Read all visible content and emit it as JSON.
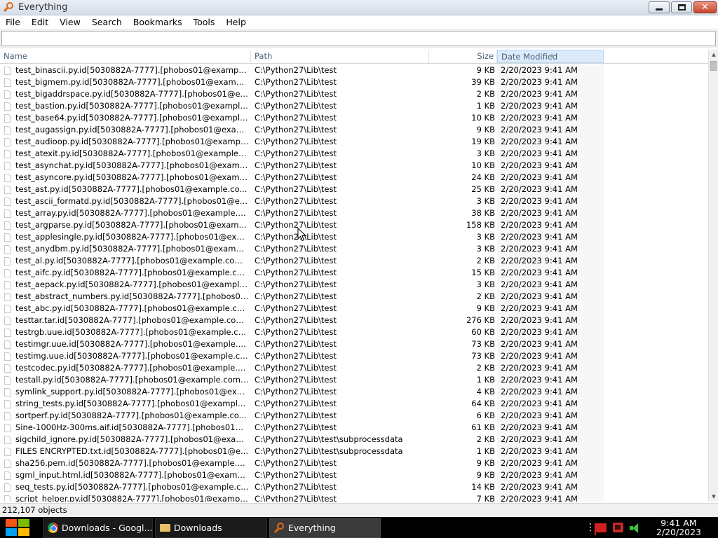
{
  "window": {
    "title": "Everything",
    "icon": "search-magnifier-icon"
  },
  "menu": [
    "File",
    "Edit",
    "View",
    "Search",
    "Bookmarks",
    "Tools",
    "Help"
  ],
  "search": {
    "value": "",
    "placeholder": ""
  },
  "columns": {
    "name": "Name",
    "path": "Path",
    "size": "Size",
    "date": "Date Modified"
  },
  "rows": [
    {
      "name": "test_binascii.py.id[5030882A-7777].[phobos01@example...",
      "path": "C:\\Python27\\Lib\\test",
      "size": "9 KB",
      "date": "2/20/2023 9:41 AM"
    },
    {
      "name": "test_bigmem.py.id[5030882A-7777].[phobos01@example...",
      "path": "C:\\Python27\\Lib\\test",
      "size": "39 KB",
      "date": "2/20/2023 9:41 AM"
    },
    {
      "name": "test_bigaddrspace.py.id[5030882A-7777].[phobos01@ex...",
      "path": "C:\\Python27\\Lib\\test",
      "size": "2 KB",
      "date": "2/20/2023 9:41 AM"
    },
    {
      "name": "test_bastion.py.id[5030882A-7777].[phobos01@example...",
      "path": "C:\\Python27\\Lib\\test",
      "size": "1 KB",
      "date": "2/20/2023 9:41 AM"
    },
    {
      "name": "test_base64.py.id[5030882A-7777].[phobos01@example...",
      "path": "C:\\Python27\\Lib\\test",
      "size": "10 KB",
      "date": "2/20/2023 9:41 AM"
    },
    {
      "name": "test_augassign.py.id[5030882A-7777].[phobos01@exam...",
      "path": "C:\\Python27\\Lib\\test",
      "size": "9 KB",
      "date": "2/20/2023 9:41 AM"
    },
    {
      "name": "test_audioop.py.id[5030882A-7777].[phobos01@exampl...",
      "path": "C:\\Python27\\Lib\\test",
      "size": "19 KB",
      "date": "2/20/2023 9:41 AM"
    },
    {
      "name": "test_atexit.py.id[5030882A-7777].[phobos01@example.c...",
      "path": "C:\\Python27\\Lib\\test",
      "size": "3 KB",
      "date": "2/20/2023 9:41 AM"
    },
    {
      "name": "test_asynchat.py.id[5030882A-7777].[phobos01@exampl...",
      "path": "C:\\Python27\\Lib\\test",
      "size": "10 KB",
      "date": "2/20/2023 9:41 AM"
    },
    {
      "name": "test_asyncore.py.id[5030882A-7777].[phobos01@examp...",
      "path": "C:\\Python27\\Lib\\test",
      "size": "24 KB",
      "date": "2/20/2023 9:41 AM"
    },
    {
      "name": "test_ast.py.id[5030882A-7777].[phobos01@example.co...",
      "path": "C:\\Python27\\Lib\\test",
      "size": "25 KB",
      "date": "2/20/2023 9:41 AM"
    },
    {
      "name": "test_ascii_formatd.py.id[5030882A-7777].[phobos01@ex...",
      "path": "C:\\Python27\\Lib\\test",
      "size": "3 KB",
      "date": "2/20/2023 9:41 AM"
    },
    {
      "name": "test_array.py.id[5030882A-7777].[phobos01@example.c...",
      "path": "C:\\Python27\\Lib\\test",
      "size": "38 KB",
      "date": "2/20/2023 9:41 AM"
    },
    {
      "name": "test_argparse.py.id[5030882A-7777].[phobos01@examp...",
      "path": "C:\\Python27\\Lib\\test",
      "size": "158 KB",
      "date": "2/20/2023 9:41 AM"
    },
    {
      "name": "test_applesingle.py.id[5030882A-7777].[phobos01@exa...",
      "path": "C:\\Python27\\Lib\\test",
      "size": "3 KB",
      "date": "2/20/2023 9:41 AM"
    },
    {
      "name": "test_anydbm.py.id[5030882A-7777].[phobos01@example...",
      "path": "C:\\Python27\\Lib\\test",
      "size": "3 KB",
      "date": "2/20/2023 9:41 AM"
    },
    {
      "name": "test_al.py.id[5030882A-7777].[phobos01@example.com]...",
      "path": "C:\\Python27\\Lib\\test",
      "size": "2 KB",
      "date": "2/20/2023 9:41 AM"
    },
    {
      "name": "test_aifc.py.id[5030882A-7777].[phobos01@example.co...",
      "path": "C:\\Python27\\Lib\\test",
      "size": "15 KB",
      "date": "2/20/2023 9:41 AM"
    },
    {
      "name": "test_aepack.py.id[5030882A-7777].[phobos01@example...",
      "path": "C:\\Python27\\Lib\\test",
      "size": "3 KB",
      "date": "2/20/2023 9:41 AM"
    },
    {
      "name": "test_abstract_numbers.py.id[5030882A-7777].[phobos01...",
      "path": "C:\\Python27\\Lib\\test",
      "size": "2 KB",
      "date": "2/20/2023 9:41 AM"
    },
    {
      "name": "test_abc.py.id[5030882A-7777].[phobos01@example.co...",
      "path": "C:\\Python27\\Lib\\test",
      "size": "9 KB",
      "date": "2/20/2023 9:41 AM"
    },
    {
      "name": "testtar.tar.id[5030882A-7777].[phobos01@example.com...",
      "path": "C:\\Python27\\Lib\\test",
      "size": "276 KB",
      "date": "2/20/2023 9:41 AM"
    },
    {
      "name": "testrgb.uue.id[5030882A-7777].[phobos01@example.co...",
      "path": "C:\\Python27\\Lib\\test",
      "size": "60 KB",
      "date": "2/20/2023 9:41 AM"
    },
    {
      "name": "testimgr.uue.id[5030882A-7777].[phobos01@example.co...",
      "path": "C:\\Python27\\Lib\\test",
      "size": "73 KB",
      "date": "2/20/2023 9:41 AM"
    },
    {
      "name": "testimg.uue.id[5030882A-7777].[phobos01@example.co...",
      "path": "C:\\Python27\\Lib\\test",
      "size": "73 KB",
      "date": "2/20/2023 9:41 AM"
    },
    {
      "name": "testcodec.py.id[5030882A-7777].[phobos01@example.c...",
      "path": "C:\\Python27\\Lib\\test",
      "size": "2 KB",
      "date": "2/20/2023 9:41 AM"
    },
    {
      "name": "testall.py.id[5030882A-7777].[phobos01@example.com]....",
      "path": "C:\\Python27\\Lib\\test",
      "size": "1 KB",
      "date": "2/20/2023 9:41 AM"
    },
    {
      "name": "symlink_support.py.id[5030882A-7777].[phobos01@exam...",
      "path": "C:\\Python27\\Lib\\test",
      "size": "4 KB",
      "date": "2/20/2023 9:41 AM"
    },
    {
      "name": "string_tests.py.id[5030882A-7777].[phobos01@example....",
      "path": "C:\\Python27\\Lib\\test",
      "size": "64 KB",
      "date": "2/20/2023 9:41 AM"
    },
    {
      "name": "sortperf.py.id[5030882A-7777].[phobos01@example.co...",
      "path": "C:\\Python27\\Lib\\test",
      "size": "6 KB",
      "date": "2/20/2023 9:41 AM"
    },
    {
      "name": "Sine-1000Hz-300ms.aif.id[5030882A-7777].[phobos01@...",
      "path": "C:\\Python27\\Lib\\test",
      "size": "61 KB",
      "date": "2/20/2023 9:41 AM"
    },
    {
      "name": "sigchild_ignore.py.id[5030882A-7777].[phobos01@examp...",
      "path": "C:\\Python27\\Lib\\test\\subprocessdata",
      "size": "2 KB",
      "date": "2/20/2023 9:41 AM"
    },
    {
      "name": "FILES ENCRYPTED.txt.id[5030882A-7777].[phobos01@e...",
      "path": "C:\\Python27\\Lib\\test\\subprocessdata",
      "size": "1 KB",
      "date": "2/20/2023 9:41 AM"
    },
    {
      "name": "sha256.pem.id[5030882A-7777].[phobos01@example.co...",
      "path": "C:\\Python27\\Lib\\test",
      "size": "9 KB",
      "date": "2/20/2023 9:41 AM"
    },
    {
      "name": "sgml_input.html.id[5030882A-7777].[phobos01@example...",
      "path": "C:\\Python27\\Lib\\test",
      "size": "9 KB",
      "date": "2/20/2023 9:41 AM"
    },
    {
      "name": "seq_tests.py.id[5030882A-7777].[phobos01@example.c...",
      "path": "C:\\Python27\\Lib\\test",
      "size": "14 KB",
      "date": "2/20/2023 9:41 AM"
    },
    {
      "name": "script_helper.py.id[5030882A-7777].[phobos01@example...",
      "path": "C:\\Python27\\Lib\\test",
      "size": "7 KB",
      "date": "2/20/2023 9:41 AM"
    }
  ],
  "status": {
    "objects": "212,107 objects"
  },
  "taskbar": {
    "tasks": [
      {
        "label": "Downloads - Googl...",
        "icon": "chrome-icon"
      },
      {
        "label": "Downloads",
        "icon": "folder-icon"
      },
      {
        "label": "Everything",
        "icon": "search-magnifier-icon"
      }
    ],
    "clock_time": "9:41 AM",
    "clock_date": "2/20/2023"
  }
}
